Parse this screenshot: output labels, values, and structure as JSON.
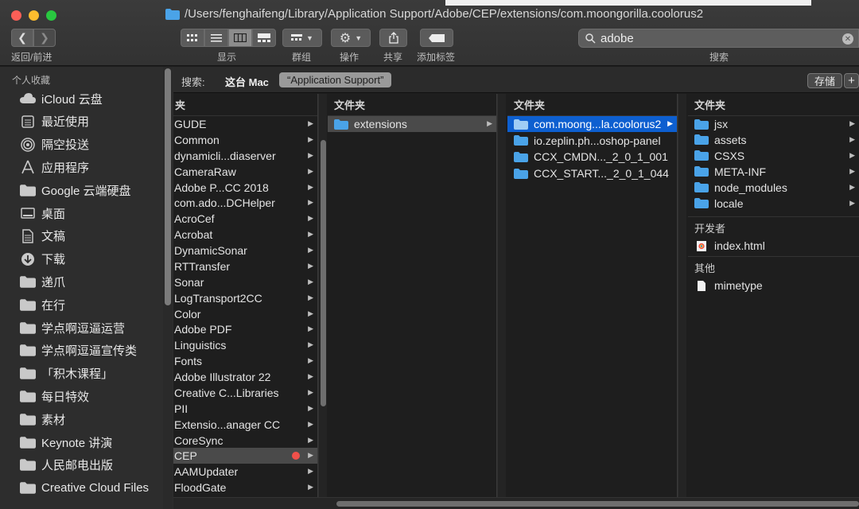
{
  "window": {
    "path": "/Users/fenghaifeng/Library/Application Support/Adobe/CEP/extensions/com.moongorilla.coolorus2"
  },
  "toolbar": {
    "nav_label": "返回/前进",
    "view_label": "显示",
    "group_label": "群组",
    "action_label": "操作",
    "share_label": "共享",
    "tag_label": "添加标签",
    "search_label": "搜索"
  },
  "search": {
    "value": "adobe"
  },
  "scope": {
    "label": "搜索:",
    "this_mac": "这台 Mac",
    "folder": "“Application Support”",
    "save": "存储",
    "add": "+"
  },
  "sidebar": {
    "section": "个人收藏",
    "items": [
      {
        "label": "iCloud 云盘",
        "icon": "cloud-icon"
      },
      {
        "label": "最近使用",
        "icon": "recents-icon"
      },
      {
        "label": "隔空投送",
        "icon": "airdrop-icon"
      },
      {
        "label": "应用程序",
        "icon": "applications-icon"
      },
      {
        "label": "Google 云端硬盘",
        "icon": "folder-icon"
      },
      {
        "label": "桌面",
        "icon": "desktop-icon"
      },
      {
        "label": "文稿",
        "icon": "documents-icon"
      },
      {
        "label": "下载",
        "icon": "downloads-icon"
      },
      {
        "label": "递爪",
        "icon": "folder-icon"
      },
      {
        "label": "在行",
        "icon": "folder-icon"
      },
      {
        "label": "学点啊逗逼运营",
        "icon": "folder-icon"
      },
      {
        "label": "学点啊逗逼宣传类",
        "icon": "folder-icon"
      },
      {
        "label": "「积木课程」",
        "icon": "folder-icon"
      },
      {
        "label": "每日特效",
        "icon": "folder-icon"
      },
      {
        "label": "素材",
        "icon": "folder-icon"
      },
      {
        "label": "Keynote 讲演",
        "icon": "folder-icon"
      },
      {
        "label": "人民邮电出版",
        "icon": "folder-icon"
      },
      {
        "label": "Creative Cloud Files",
        "icon": "folder-icon"
      }
    ]
  },
  "columns": {
    "col1": {
      "header": "夹",
      "items": [
        "GUDE",
        "Common",
        "dynamicli...diaserver",
        "CameraRaw",
        "Adobe P...CC 2018",
        "com.ado...DCHelper",
        "AcroCef",
        "Acrobat",
        "DynamicSonar",
        "RTTransfer",
        "Sonar",
        "LogTransport2CC",
        "Color",
        "Adobe PDF",
        "Linguistics",
        "Fonts",
        "Adobe Illustrator 22",
        "Creative C...Libraries",
        "PII",
        "Extensio...anager CC",
        "CoreSync",
        "CEP",
        "AAMUpdater",
        "FloodGate"
      ],
      "selected": "CEP"
    },
    "col2": {
      "header": "文件夹",
      "items": [
        "extensions"
      ],
      "selected": "extensions"
    },
    "col3": {
      "header": "文件夹",
      "items": [
        "com.moong...la.coolorus2",
        "io.zeplin.ph...oshop-panel",
        "CCX_CMDN..._2_0_1_001",
        "CCX_START..._2_0_1_044"
      ],
      "selected": "com.moong...la.coolorus2"
    },
    "col4": {
      "header": "文件夹",
      "folders": [
        "jsx",
        "assets",
        "CSXS",
        "META-INF",
        "node_modules",
        "locale"
      ],
      "dev_header": "开发者",
      "dev_files": [
        "index.html"
      ],
      "other_header": "其他",
      "other_files": [
        "mimetype"
      ]
    }
  },
  "colors": {
    "folder_blue": "#4aa3e8",
    "selection_blue": "#0d5fd0",
    "tag_red": "#f0504a"
  }
}
